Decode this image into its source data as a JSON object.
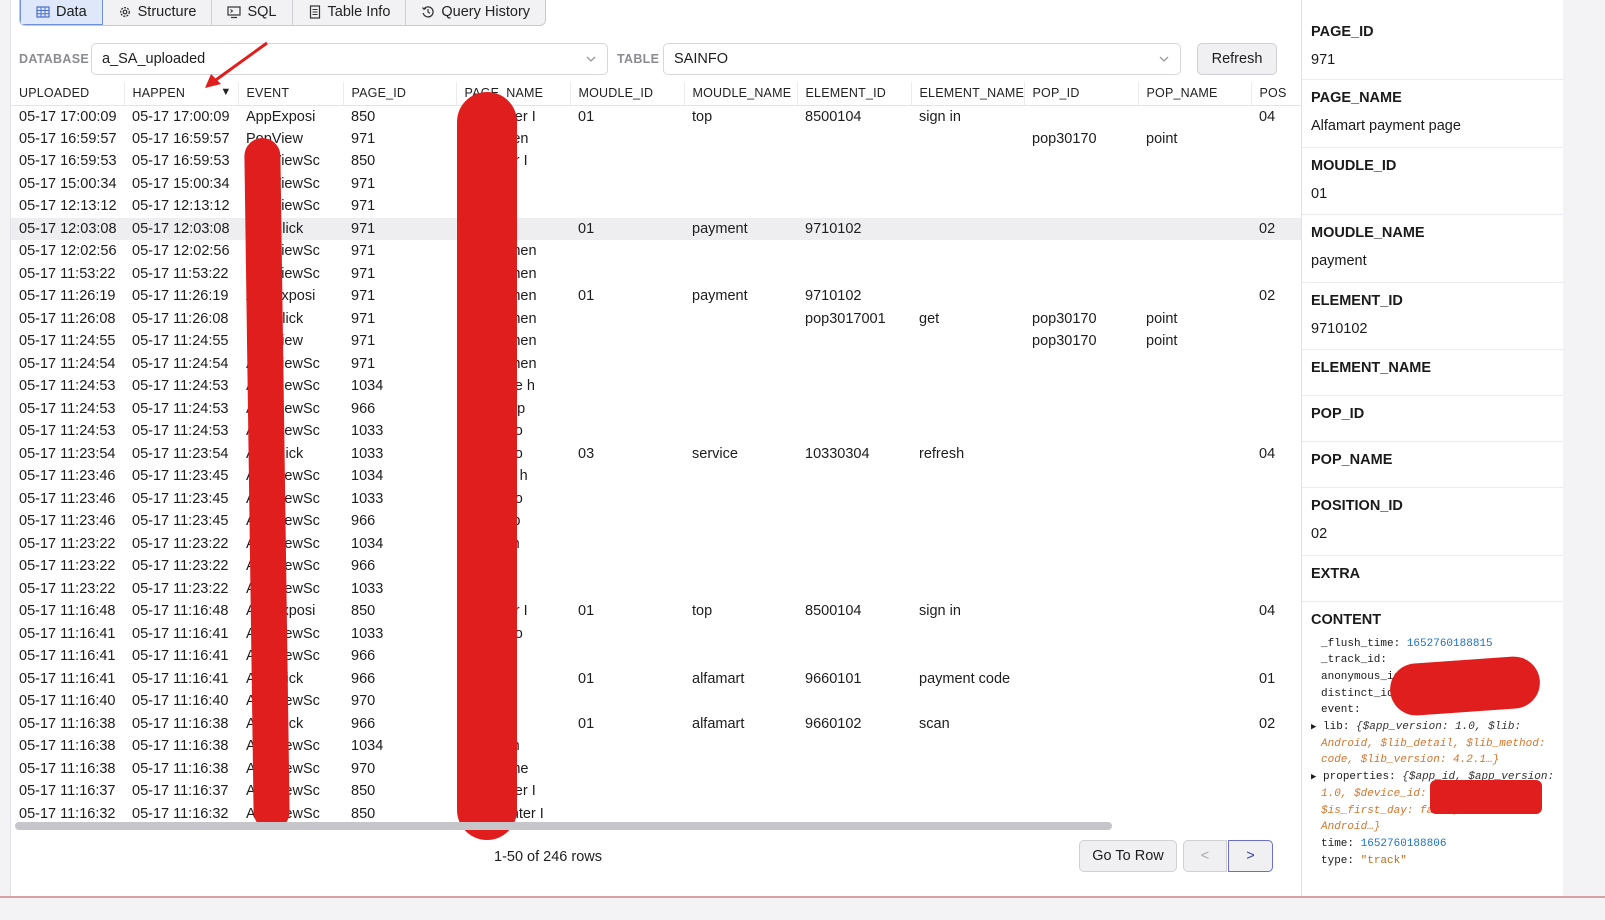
{
  "tabs": [
    {
      "label": "Data",
      "icon": "table-icon",
      "active": true
    },
    {
      "label": "Structure",
      "icon": "gear-icon"
    },
    {
      "label": "SQL",
      "icon": "terminal-icon"
    },
    {
      "label": "Table Info",
      "icon": "document-icon"
    },
    {
      "label": "Query History",
      "icon": "history-icon"
    }
  ],
  "filters": {
    "database_label": "DATABASE",
    "database_value": "a_SA_uploaded",
    "table_label": "TABLE",
    "table_value": "SAINFO",
    "refresh_label": "Refresh"
  },
  "columns": [
    "UPLOADED",
    "HAPPEN",
    "EVENT",
    "PAGE_ID",
    "PAGE_NAME",
    "MOUDLE_ID",
    "MOUDLE_NAME",
    "ELEMENT_ID",
    "ELEMENT_NAME",
    "POP_ID",
    "POP_NAME",
    "POS"
  ],
  "sort_indicator": "▼",
  "rows": [
    [
      "05-17 17:00:09",
      "05-17 17:00:09",
      "AppExposi",
      "850",
      "nal center I",
      "01",
      "top",
      "8500104",
      "sign in",
      "",
      "",
      "04"
    ],
    [
      "05-17 16:59:57",
      "05-17 16:59:57",
      "PopView",
      "971",
      "rt paymen",
      "",
      "",
      "",
      "",
      "pop30170",
      "point",
      ""
    ],
    [
      "05-17 16:59:53",
      "05-17 16:59:53",
      "AppViewSc",
      "850",
      "al center I",
      "",
      "",
      "",
      "",
      "",
      "",
      ""
    ],
    [
      "05-17 15:00:34",
      "05-17 15:00:34",
      "AppViewSc",
      "971",
      "paymen",
      "",
      "",
      "",
      "",
      "",
      "",
      ""
    ],
    [
      "05-17 12:13:12",
      "05-17 12:13:12",
      "AppViewSc",
      "971",
      "aymen",
      "",
      "",
      "",
      "",
      "",
      "",
      ""
    ],
    [
      "05-17 12:03:08",
      "05-17 12:03:08",
      "AppClick",
      "971",
      "aymen",
      "01",
      "payment",
      "9710102",
      "",
      "",
      "",
      "02"
    ],
    [
      "05-17 12:02:56",
      "05-17 12:02:56",
      "AppViewSc",
      "971",
      "art paymen",
      "",
      "",
      "",
      "",
      "",
      "",
      ""
    ],
    [
      "05-17 11:53:22",
      "05-17 11:53:22",
      "AppViewSc",
      "971",
      "art paymen",
      "",
      "",
      "",
      "",
      "",
      "",
      ""
    ],
    [
      "05-17 11:26:19",
      "05-17 11:26:19",
      "AppExposi",
      "971",
      "art paymen",
      "01",
      "payment",
      "9710102",
      "",
      "",
      "",
      "02"
    ],
    [
      "05-17 11:26:08",
      "05-17 11:26:08",
      "PopClick",
      "971",
      "art paymen",
      "",
      "",
      "pop3017001",
      "get",
      "pop30170",
      "point",
      ""
    ],
    [
      "05-17 11:24:55",
      "05-17 11:24:55",
      "PopView",
      "971",
      "art paymen",
      "",
      "",
      "",
      "",
      "pop30170",
      "point",
      ""
    ],
    [
      "05-17 11:24:54",
      "05-17 11:24:54",
      "AppViewSc",
      "971",
      "art paymen",
      "",
      "",
      "",
      "",
      "",
      "",
      ""
    ],
    [
      "05-17 11:24:53",
      "05-17 11:24:53",
      "AppViewSc",
      "1034",
      "can code h",
      "",
      "",
      "",
      "",
      "",
      "",
      ""
    ],
    [
      "05-17 11:24:53",
      "05-17 11:24:53",
      "AppViewSc",
      "966",
      "rt home p",
      "",
      "",
      "",
      "",
      "",
      "",
      ""
    ],
    [
      "05-17 11:24:53",
      "05-17 11:24:53",
      "AppViewSc",
      "1033",
      "yment co",
      "",
      "",
      "",
      "",
      "",
      "",
      ""
    ],
    [
      "05-17 11:23:54",
      "05-17 11:23:54",
      "AppClick",
      "1033",
      "yment co",
      "03",
      "service",
      "10330304",
      "refresh",
      "",
      "",
      "04"
    ],
    [
      "05-17 11:23:46",
      "05-17 11:23:45",
      "AppViewSc",
      "1034",
      "an code h",
      "",
      "",
      "",
      "",
      "",
      "",
      ""
    ],
    [
      "05-17 11:23:46",
      "05-17 11:23:45",
      "AppViewSc",
      "1033",
      "yment co",
      "",
      "",
      "",
      "",
      "",
      "",
      ""
    ],
    [
      "05-17 11:23:46",
      "05-17 11:23:45",
      "AppViewSc",
      "966",
      "t home p",
      "",
      "",
      "",
      "",
      "",
      "",
      ""
    ],
    [
      "05-17 11:23:22",
      "05-17 11:23:22",
      "AppViewSc",
      "1034",
      "n code h",
      "",
      "",
      "",
      "",
      "",
      "",
      ""
    ],
    [
      "05-17 11:23:22",
      "05-17 11:23:22",
      "AppViewSc",
      "966",
      "home p",
      "",
      "",
      "",
      "",
      "",
      "",
      ""
    ],
    [
      "05-17 11:23:22",
      "05-17 11:23:22",
      "AppViewSc",
      "1033",
      "ment co",
      "",
      "",
      "",
      "",
      "",
      "",
      ""
    ],
    [
      "05-17 11:16:48",
      "05-17 11:16:48",
      "AppExposi",
      "850",
      "al center I",
      "01",
      "top",
      "8500104",
      "sign in",
      "",
      "",
      "04"
    ],
    [
      "05-17 11:16:41",
      "05-17 11:16:41",
      "AppViewSc",
      "1033",
      "yment co",
      "",
      "",
      "",
      "",
      "",
      "",
      ""
    ],
    [
      "05-17 11:16:41",
      "05-17 11:16:41",
      "AppViewSc",
      "966",
      "home p",
      "",
      "",
      "",
      "",
      "",
      "",
      ""
    ],
    [
      "05-17 11:16:41",
      "05-17 11:16:41",
      "AppClick",
      "966",
      "home p",
      "01",
      "alfamart",
      "9660101",
      "payment code",
      "",
      "",
      "01"
    ],
    [
      "05-17 11:16:40",
      "05-17 11:16:40",
      "AppViewSc",
      "970",
      "e home",
      "",
      "",
      "",
      "",
      "",
      "",
      ""
    ],
    [
      "05-17 11:16:38",
      "05-17 11:16:38",
      "AppClick",
      "966",
      "home p",
      "01",
      "alfamart",
      "9660102",
      "scan",
      "",
      "",
      "02"
    ],
    [
      "05-17 11:16:38",
      "05-17 11:16:38",
      "AppViewSc",
      "1034",
      "n code h",
      "",
      "",
      "",
      "",
      "",
      "",
      ""
    ],
    [
      "05-17 11:16:38",
      "05-17 11:16:38",
      "AppViewSc",
      "970",
      "ode home",
      "",
      "",
      "",
      "",
      "",
      "",
      ""
    ],
    [
      "05-17 11:16:37",
      "05-17 11:16:37",
      "AppViewSc",
      "850",
      "nal center I",
      "",
      "",
      "",
      "",
      "",
      "",
      ""
    ],
    [
      "05-17 11:16:32",
      "05-17 11:16:32",
      "AppViewSc",
      "850",
      "onal center I",
      "",
      "",
      "",
      "",
      "",
      "",
      ""
    ]
  ],
  "footer": {
    "rows_text": "1-50 of 246 rows",
    "goto_label": "Go To Row",
    "prev_label": "<",
    "next_label": ">"
  },
  "detail": {
    "fields": [
      {
        "name": "PAGE_ID",
        "value": "971"
      },
      {
        "name": "PAGE_NAME",
        "value": "Alfamart payment page"
      },
      {
        "name": "MOUDLE_ID",
        "value": "01"
      },
      {
        "name": "MOUDLE_NAME",
        "value": "payment"
      },
      {
        "name": "ELEMENT_ID",
        "value": "9710102"
      },
      {
        "name": "ELEMENT_NAME",
        "value": ""
      },
      {
        "name": "POP_ID",
        "value": ""
      },
      {
        "name": "POP_NAME",
        "value": ""
      },
      {
        "name": "POSITION_ID",
        "value": "02"
      },
      {
        "name": "EXTRA",
        "value": ""
      }
    ],
    "content_label": "CONTENT",
    "content": {
      "flush_key": "_flush_time:",
      "flush_val": "1652760188815",
      "track_key": "_track_id:",
      "anon_key": "anonymous_id:",
      "distinct_key": "distinct_id:",
      "event_key": "event:",
      "lib_key": "lib:",
      "lib_line1": "{$app_version: 1.0, $lib:",
      "lib_line2": "Android, $lib_detail, $lib_method:",
      "lib_line3": "code, $lib_version: 4.2.1…}",
      "props_key": "properties:",
      "props_line1": "{$app_id, $app_version:",
      "props_line2": "1.0, $device_id:",
      "props_line3": "$is_first_day: false, $lib:",
      "props_line4": "Android…}",
      "time_key": "time:",
      "time_val": "1652760188806",
      "type_key": "type:",
      "type_val": "\"track\""
    }
  }
}
